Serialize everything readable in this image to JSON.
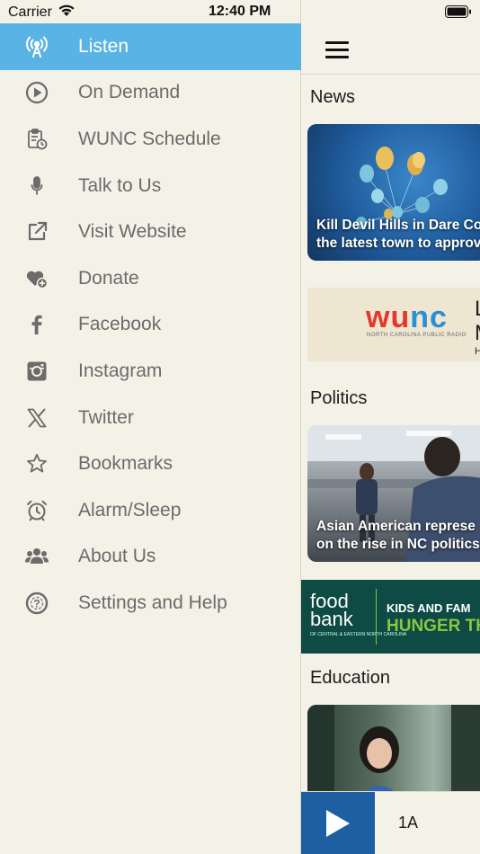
{
  "status_bar": {
    "carrier": "Carrier",
    "time": "12:40 PM"
  },
  "sidebar": {
    "items": [
      {
        "label": "Listen",
        "icon": "radio-tower-icon",
        "active": true
      },
      {
        "label": "On Demand",
        "icon": "play-circle-icon"
      },
      {
        "label": "WUNC Schedule",
        "icon": "schedule-icon"
      },
      {
        "label": "Talk to Us",
        "icon": "microphone-icon"
      },
      {
        "label": "Visit Website",
        "icon": "external-link-icon"
      },
      {
        "label": "Donate",
        "icon": "heart-plus-icon"
      },
      {
        "label": "Facebook",
        "icon": "facebook-icon"
      },
      {
        "label": "Instagram",
        "icon": "instagram-icon"
      },
      {
        "label": "Twitter",
        "icon": "x-logo-icon"
      },
      {
        "label": "Bookmarks",
        "icon": "star-icon"
      },
      {
        "label": "Alarm/Sleep",
        "icon": "alarm-clock-icon"
      },
      {
        "label": "About Us",
        "icon": "users-icon"
      },
      {
        "label": "Settings and Help",
        "icon": "help-circle-icon"
      }
    ],
    "active_color": "#5ab3e5",
    "icon_color": "#6b6b6b"
  },
  "main": {
    "sections": {
      "news": {
        "title": "News",
        "card_caption_1": "Kill Devil Hills in Dare Co",
        "card_caption_2": "the latest town to approv"
      },
      "politics": {
        "title": "Politics",
        "card_caption_1": "Asian American represe",
        "card_caption_2": "on the rise in NC politics"
      },
      "education": {
        "title": "Education"
      }
    },
    "ads": {
      "wunc": {
        "logo": [
          "w",
          "u",
          "n",
          "c"
        ],
        "subtitle": "NORTH CAROLINA PUBLIC RADIO",
        "side_letters": [
          "L",
          "M",
          "H"
        ]
      },
      "foodbank": {
        "logo_line1": "food",
        "logo_line2": "bank",
        "logo_small": "OF CENTRAL & EASTERN NORTH CAROLINA",
        "headline_1": "KIDS AND FAM",
        "headline_2": "HUNGER TH"
      }
    },
    "player": {
      "now_playing": "1A"
    },
    "colors": {
      "player_button": "#1d5fa0",
      "foodbank_bg": "#0d4b44",
      "foodbank_accent": "#8cc63f"
    }
  }
}
